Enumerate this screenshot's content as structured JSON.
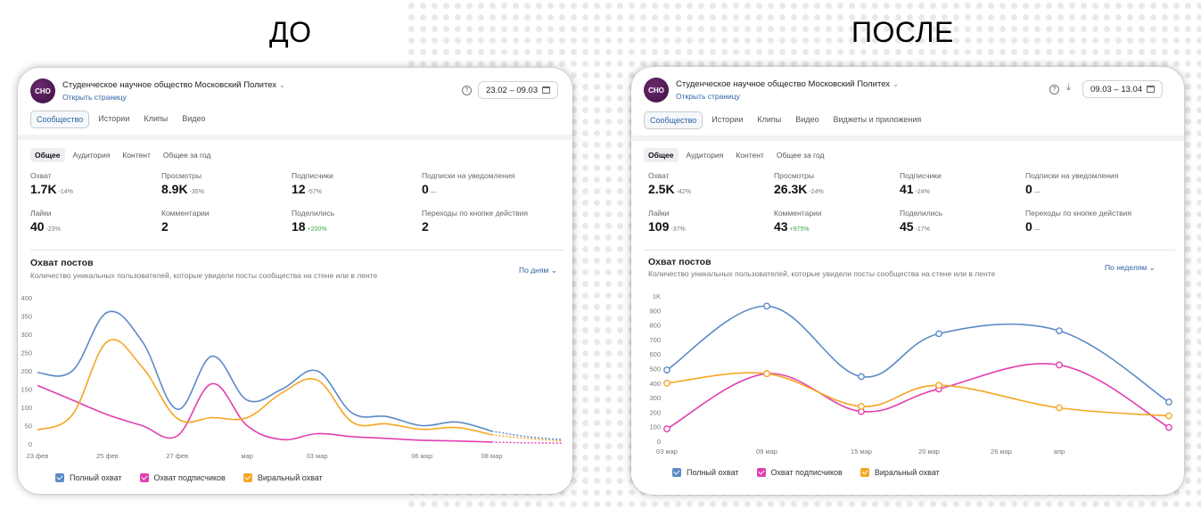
{
  "labels": {
    "before": "ДО",
    "after": "ПОСЛЕ"
  },
  "colors": {
    "full": "#5b8ac6",
    "subs": "#e23fb1",
    "viral": "#f5a623",
    "accent": "#2d64a5"
  },
  "before": {
    "logo_text": "СНО",
    "org_name": "Студенческое научное общество Московский Политех",
    "open_page": "Открыть страницу",
    "date_range": "23.02 – 09.03",
    "tabs": [
      "Сообщество",
      "Истории",
      "Клипы",
      "Видео"
    ],
    "subtabs": [
      "Общее",
      "Аудитория",
      "Контент",
      "Общее за год"
    ],
    "metrics": [
      {
        "label": "Охват",
        "value": "1.7K",
        "delta": "-14%"
      },
      {
        "label": "Просмотры",
        "value": "8.9K",
        "delta": "-35%"
      },
      {
        "label": "Подписчики",
        "value": "12",
        "delta": "-57%"
      },
      {
        "label": "Подписки на уведомления",
        "value": "0",
        "delta": "—"
      },
      {
        "label": "Лайки",
        "value": "40",
        "delta": "-23%"
      },
      {
        "label": "Комментарии",
        "value": "2",
        "delta": ""
      },
      {
        "label": "Поделились",
        "value": "18",
        "delta": "+200%"
      },
      {
        "label": "Переходы по кнопке действия",
        "value": "2",
        "delta": ""
      }
    ],
    "section_title": "Охват постов",
    "section_sub": "Количество уникальных пользователей, которые увидели посты сообщества на стене или в ленте",
    "period": "По дням",
    "legend": [
      "Полный охват",
      "Охват подписчиков",
      "Виральный охват"
    ]
  },
  "after": {
    "logo_text": "СНО",
    "org_name": "Студенческое научное общество Московский Политех",
    "open_page": "Открыть страницу",
    "date_range": "09.03 – 13.04",
    "tabs": [
      "Сообщество",
      "Истории",
      "Клипы",
      "Видео",
      "Виджеты и приложения"
    ],
    "subtabs": [
      "Общее",
      "Аудитория",
      "Контент",
      "Общее за год"
    ],
    "metrics": [
      {
        "label": "Охват",
        "value": "2.5K",
        "delta": "-42%"
      },
      {
        "label": "Просмотры",
        "value": "26.3K",
        "delta": "-24%"
      },
      {
        "label": "Подписчики",
        "value": "41",
        "delta": "-24%"
      },
      {
        "label": "Подписки на уведомления",
        "value": "0",
        "delta": "—"
      },
      {
        "label": "Лайки",
        "value": "109",
        "delta": "-37%"
      },
      {
        "label": "Комментарии",
        "value": "43",
        "delta": "+975%"
      },
      {
        "label": "Поделились",
        "value": "45",
        "delta": "-17%"
      },
      {
        "label": "Переходы по кнопке действия",
        "value": "0",
        "delta": "—"
      }
    ],
    "section_title": "Охват постов",
    "section_sub": "Количество уникальных пользователей, которые увидели посты сообщества на стене или в ленте",
    "period": "По неделям",
    "legend": [
      "Полный охват",
      "Охват подписчиков",
      "Виральный охват"
    ]
  },
  "chart_data": [
    {
      "type": "line",
      "x": [
        "23 фев",
        "24 фев",
        "25 фев",
        "26 фев",
        "27 фев",
        "28 фев",
        "29 фев",
        "01 мар",
        "02 мар",
        "03 мар",
        "04 мар",
        "05 мар",
        "06 мар",
        "07 мар",
        "08 мар",
        "09 мар"
      ],
      "x_tick_labels": [
        "23 фев",
        "25 фев",
        "27 фев",
        "мар",
        "03 мар",
        "06 мар",
        "08 мар"
      ],
      "y_ticks": [
        0,
        50,
        100,
        150,
        200,
        250,
        300,
        350,
        400
      ],
      "ylim": [
        0,
        400
      ],
      "series": [
        {
          "name": "Полный охват",
          "values": [
            195,
            200,
            360,
            280,
            95,
            240,
            120,
            150,
            200,
            85,
            75,
            50,
            60,
            35,
            20,
            12
          ]
        },
        {
          "name": "Охват подписчиков",
          "values": [
            160,
            120,
            80,
            50,
            22,
            165,
            50,
            12,
            28,
            20,
            15,
            10,
            8,
            5,
            3,
            2
          ]
        },
        {
          "name": "Виральный охват",
          "values": [
            38,
            80,
            280,
            210,
            70,
            72,
            72,
            140,
            175,
            60,
            55,
            40,
            45,
            25,
            15,
            8
          ]
        }
      ],
      "grid": false,
      "legend_position": "bottom"
    },
    {
      "type": "line",
      "x": [
        "03 мар",
        "09 мар",
        "15 мар",
        "20 мар",
        "26 мар",
        "апр",
        "13 апр"
      ],
      "x_tick_labels": [
        "03 мар",
        "09 мар",
        "15 мар",
        "20 мар",
        "26 мар",
        "апр"
      ],
      "y_ticks": [
        "0",
        "100",
        "200",
        "300",
        "400",
        "500",
        "600",
        "700",
        "800",
        "900",
        "1K"
      ],
      "ylim": [
        0,
        1000
      ],
      "series": [
        {
          "name": "Полный охват",
          "values": [
            490,
            930,
            445,
            740,
            760,
            270
          ]
        },
        {
          "name": "Охват подписчиков",
          "values": [
            85,
            465,
            205,
            360,
            525,
            95
          ]
        },
        {
          "name": "Виральный охват",
          "values": [
            400,
            465,
            240,
            385,
            230,
            175
          ]
        }
      ],
      "grid": false,
      "legend_position": "bottom"
    }
  ]
}
